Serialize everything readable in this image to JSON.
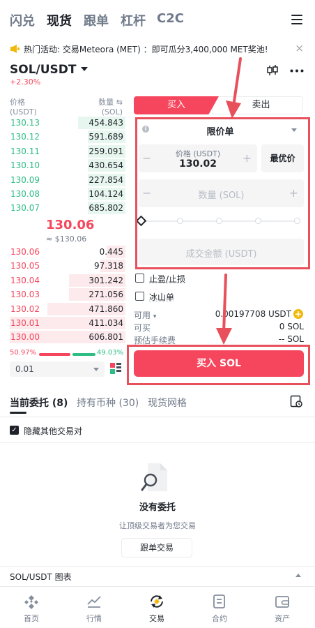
{
  "nav": {
    "tabs": [
      {
        "label": "闪兑",
        "active": false
      },
      {
        "label": "现货",
        "active": true
      },
      {
        "label": "跟单",
        "active": false
      },
      {
        "label": "杠杆",
        "active": false
      },
      {
        "label": "C2C",
        "active": false
      }
    ]
  },
  "announcement": {
    "text": "热门活动: 交易Meteora (MET) ：即可瓜分3,400,000 MET奖池!",
    "close": "×"
  },
  "pair": {
    "symbol": "SOL/USDT",
    "change": "+2.30%"
  },
  "orderbook": {
    "price_header": "价格",
    "price_unit": "(USDT)",
    "qty_header": "数量 ⇆",
    "qty_unit": "(SOL)",
    "bids": [
      {
        "price": "130.13",
        "qty": "454.843",
        "depth": 0.38
      },
      {
        "price": "130.12",
        "qty": "591.689",
        "depth": 0.3
      },
      {
        "price": "130.11",
        "qty": "259.091",
        "depth": 0.3
      },
      {
        "price": "130.10",
        "qty": "430.654",
        "depth": 0.3
      },
      {
        "price": "130.09",
        "qty": "227.854",
        "depth": 0.3
      },
      {
        "price": "130.08",
        "qty": "104.124",
        "depth": 0.3
      },
      {
        "price": "130.07",
        "qty": "685.802",
        "depth": 0.3
      }
    ],
    "mid_price": "130.06",
    "mid_usd": "≈ $130.06",
    "asks": [
      {
        "price": "130.06",
        "qty": "0.445",
        "depth": 0.15
      },
      {
        "price": "130.05",
        "qty": "97.318",
        "depth": 0.2
      },
      {
        "price": "130.04",
        "qty": "301.242",
        "depth": 0.45
      },
      {
        "price": "130.03",
        "qty": "271.056",
        "depth": 0.45
      },
      {
        "price": "130.02",
        "qty": "471.860",
        "depth": 0.62
      },
      {
        "price": "130.01",
        "qty": "411.034",
        "depth": 0.92
      },
      {
        "price": "130.00",
        "qty": "606.801",
        "depth": 0.92
      }
    ],
    "buy_ratio": "50.97%",
    "sell_ratio": "49.03%",
    "step": "0.01"
  },
  "trade": {
    "buy_tab": "买入",
    "sell_tab": "卖出",
    "order_type": "限价单",
    "price_label": "价格 (USDT)",
    "price_value": "130.02",
    "best_price": "最优价",
    "qty_placeholder": "数量 (SOL)",
    "total_placeholder": "成交金额 (USDT)",
    "tpsl": "止盈/止损",
    "iceberg": "冰山单",
    "available_label": "可用",
    "available_value": "0.00197708 USDT",
    "can_buy_label": "可买",
    "can_buy_value": "0 SOL",
    "fee_label": "预估手续费",
    "fee_value": "-- SOL",
    "buy_button": "买入 SOL"
  },
  "orders": {
    "tabs": [
      {
        "label": "当前委托 (8)",
        "active": true
      },
      {
        "label": "持有币种 (30)",
        "active": false
      },
      {
        "label": "现货网格",
        "active": false
      }
    ],
    "hide_others": "隐藏其他交易对",
    "empty_title": "没有委托",
    "empty_sub": "让顶级交易者为您交易",
    "copy_button": "跟单交易"
  },
  "chart_bar": {
    "label": "SOL/USDT 图表"
  },
  "bottom_nav": [
    {
      "label": "首页",
      "icon": "home-icon",
      "active": false
    },
    {
      "label": "行情",
      "icon": "markets-icon",
      "active": false
    },
    {
      "label": "交易",
      "icon": "trade-icon",
      "active": true
    },
    {
      "label": "合约",
      "icon": "futures-icon",
      "active": false
    },
    {
      "label": "资产",
      "icon": "wallet-icon",
      "active": false
    }
  ],
  "colors": {
    "buy": "#f6465d",
    "bid": "#2ebd85",
    "annotation": "#e8505b"
  }
}
